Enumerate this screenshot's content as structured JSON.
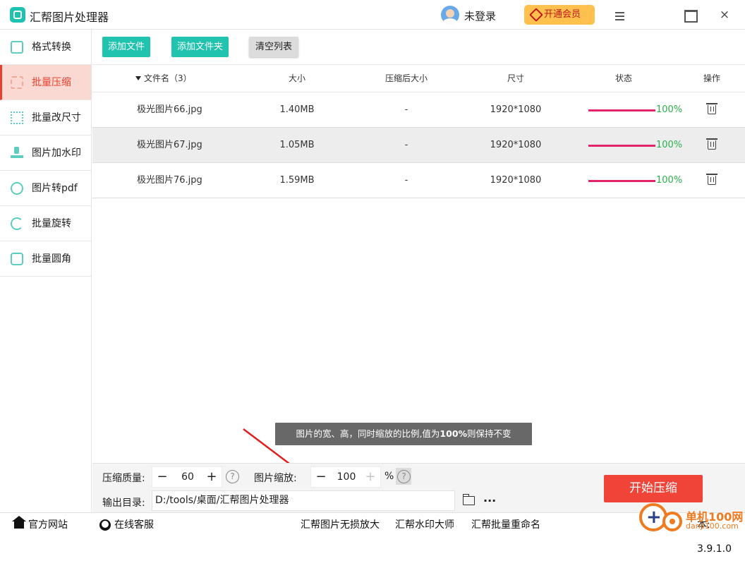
{
  "app": {
    "title": "汇帮图片处理器"
  },
  "header": {
    "login_label": "未登录",
    "vip_label": "开通会员",
    "close_label": "×"
  },
  "sidebar": {
    "items": [
      {
        "label": "格式转换",
        "icon": "format-convert-icon"
      },
      {
        "label": "批量压缩",
        "icon": "compress-icon",
        "active": true
      },
      {
        "label": "批量改尺寸",
        "icon": "resize-icon"
      },
      {
        "label": "图片加水印",
        "icon": "watermark-icon"
      },
      {
        "label": "图片转pdf",
        "icon": "pdf-icon"
      },
      {
        "label": "批量旋转",
        "icon": "rotate-icon"
      },
      {
        "label": "批量圆角",
        "icon": "rounded-corner-icon"
      }
    ]
  },
  "toolbar": {
    "add_file": "添加文件",
    "add_folder": "添加文件夹",
    "clear_list": "清空列表"
  },
  "table": {
    "headers": {
      "name": "文件名（3）",
      "size": "大小",
      "after": "压缩后大小",
      "dim": "尺寸",
      "status": "状态",
      "op": "操作"
    },
    "rows": [
      {
        "name": "极光图片66.jpg",
        "size": "1.40MB",
        "after": "-",
        "dim": "1920*1080",
        "progress": 100,
        "status": "100%"
      },
      {
        "name": "极光图片67.jpg",
        "size": "1.05MB",
        "after": "-",
        "dim": "1920*1080",
        "progress": 100,
        "status": "100%"
      },
      {
        "name": "极光图片76.jpg",
        "size": "1.59MB",
        "after": "-",
        "dim": "1920*1080",
        "progress": 100,
        "status": "100%"
      }
    ]
  },
  "tooltip": {
    "before": "图片的宽、高，同时缩放的比例,值为",
    "bold": "100%",
    "after": "则保持不变"
  },
  "settings": {
    "quality_label": "压缩质量:",
    "quality_value": "60",
    "scale_label": "图片缩放:",
    "scale_value": "100",
    "percent": "%",
    "help": "?",
    "minus": "−",
    "plus": "+",
    "output_label": "输出目录:",
    "output_path": "D:/tools/桌面/汇帮图片处理器",
    "more": "···",
    "start_button": "开始压缩"
  },
  "footer": {
    "website": "官方网站",
    "service": "在线客服",
    "link1": "汇帮图片无损放大",
    "link2": "汇帮水印大师",
    "link3": "汇帮批量重命名",
    "version": "本: 3.9.1.0"
  },
  "watermark": {
    "brand": "单机100网",
    "domain": "danji100.com"
  },
  "colors": {
    "accent": "#20c3ae",
    "active_red": "#e8422e",
    "progress": "#e3246a",
    "start": "#f04438",
    "vip": "#ffc04d"
  }
}
